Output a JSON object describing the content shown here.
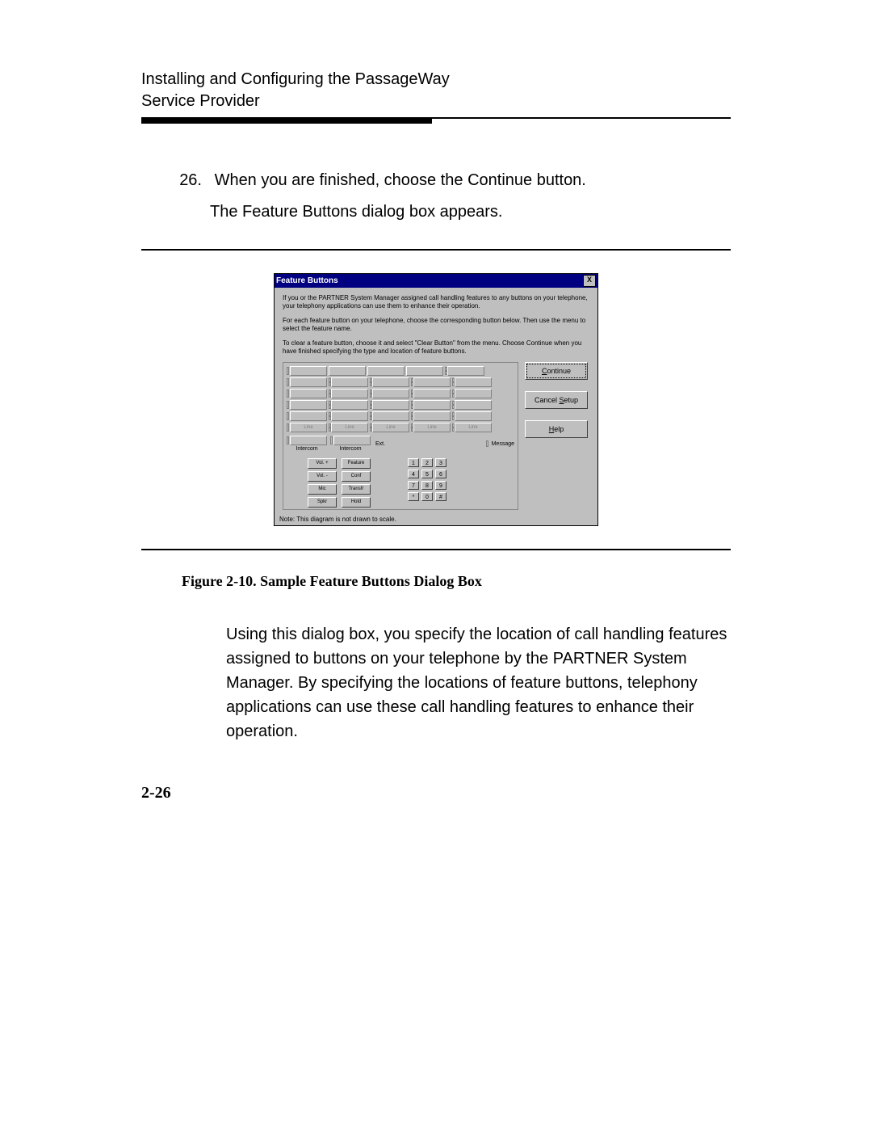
{
  "header": {
    "line1": "Installing and Configuring the PassageWay",
    "line2": "Service Provider"
  },
  "step": {
    "num": "26.",
    "text": "When you are finished, choose the Continue button.",
    "sub": "The Feature Buttons dialog box appears."
  },
  "dialog": {
    "title": "Feature Buttons",
    "close": "X",
    "p1": "If you or the PARTNER System Manager assigned call handling features to any buttons on your telephone, your telephony applications can use them to enhance their operation.",
    "p2": "For each feature button on your telephone, choose the corresponding button below. Then use the menu to select the feature name.",
    "p3": "To clear a feature button, choose it and select \"Clear Button\" from the menu.  Choose Continue when you have finished specifying the type and location of feature buttons.",
    "buttons": {
      "continue_pre": "C",
      "continue_rest": "ontinue",
      "cancel_pre": "Cancel ",
      "cancel_u": "S",
      "cancel_post": "etup",
      "help_pre": "",
      "help_u": "H",
      "help_post": "elp"
    },
    "phone": {
      "line": "Line",
      "intercom": "Intercom",
      "ext": "Ext.",
      "message": "Message",
      "keys": {
        "volup": "Vol. +",
        "voldn": "Vol. -",
        "mic": "Mic",
        "spkr": "Spkr",
        "feature": "Feature",
        "conf": "Conf",
        "transfr": "Transfr",
        "hold": "Hold"
      },
      "dial": [
        "1",
        "2",
        "3",
        "4",
        "5",
        "6",
        "7",
        "8",
        "9",
        "*",
        "0",
        "#"
      ]
    },
    "note": "Note: This diagram is not drawn to scale."
  },
  "caption": "Figure 2-10.  Sample Feature Buttons Dialog Box",
  "body_para": "Using this dialog box, you specify the location of call handling features assigned to buttons on your telephone by the PARTNER System Manager. By specifying the locations of feature buttons, telephony applications can use these call handling features to enhance their operation.",
  "page_num": "2-26"
}
